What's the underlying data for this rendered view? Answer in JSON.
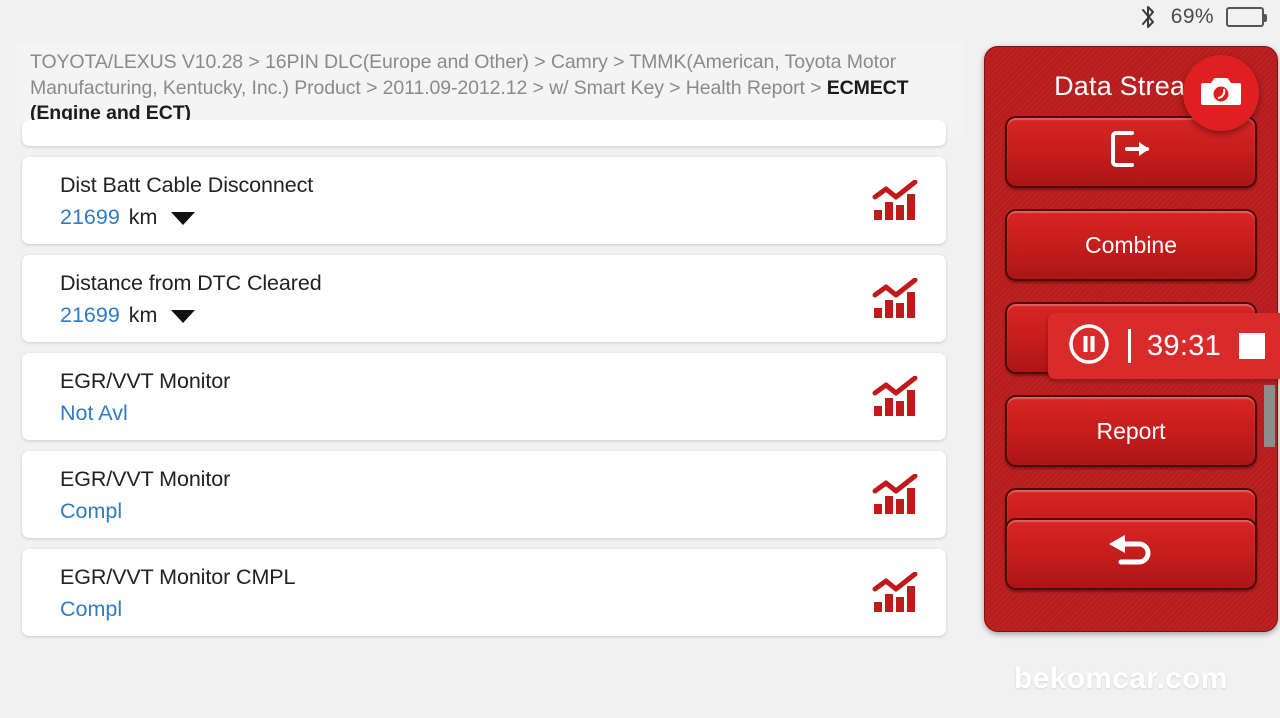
{
  "status_bar": {
    "bluetooth_icon": "bluetooth-icon",
    "battery_percent": "69%",
    "battery_level": 69,
    "battery_icon": "battery-icon"
  },
  "breadcrumb": {
    "path_text": "TOYOTA/LEXUS V10.28 > 16PIN DLC(Europe and Other) > Camry > TMMK(American, Toyota Motor Manufacturing, Kentucky, Inc.) Product > 2011.09-2012.12 > w/ Smart Key > Health Report",
    "separator": "> ",
    "current": "ECMECT (Engine and ECT)"
  },
  "list": {
    "graph_icon": "bar-chart-icon",
    "dropdown_icon": "caret-down-icon",
    "rows": [
      {
        "label": "",
        "value": "",
        "unit": "",
        "partial": true
      },
      {
        "label": "Dist Batt Cable Disconnect",
        "value": "21699",
        "unit": "km",
        "has_dropdown": true
      },
      {
        "label": "Distance from DTC Cleared",
        "value": "21699",
        "unit": "km",
        "has_dropdown": true
      },
      {
        "label": "EGR/VVT Monitor",
        "value": "Not Avl",
        "unit": "",
        "has_dropdown": false
      },
      {
        "label": "EGR/VVT Monitor",
        "value": "Compl",
        "unit": "",
        "has_dropdown": false
      },
      {
        "label": "EGR/VVT Monitor CMPL",
        "value": "Compl",
        "unit": "",
        "has_dropdown": false
      }
    ]
  },
  "side_panel": {
    "title": "Data Stream",
    "camera_icon": "camera-icon",
    "exit_icon": "exit-icon",
    "back_icon": "back-arrow-icon",
    "buttons": {
      "exit_label": "",
      "combine_label": "Combine",
      "report_label": "Report",
      "blank_label": "",
      "back_label": ""
    },
    "recording": {
      "pause_icon": "pause-circle-icon",
      "elapsed": "39:31",
      "stop_icon": "stop-square-icon"
    },
    "scrollbar": "vertical-scrollbar"
  },
  "watermark": {
    "text": "bekomcar.com"
  },
  "colors": {
    "panel_red": "#b81d1d",
    "button_red": "#c41c1c",
    "value_blue": "#2f7cc2",
    "chart_icon_red": "#c11a1a",
    "background": "#f1f1f1"
  }
}
